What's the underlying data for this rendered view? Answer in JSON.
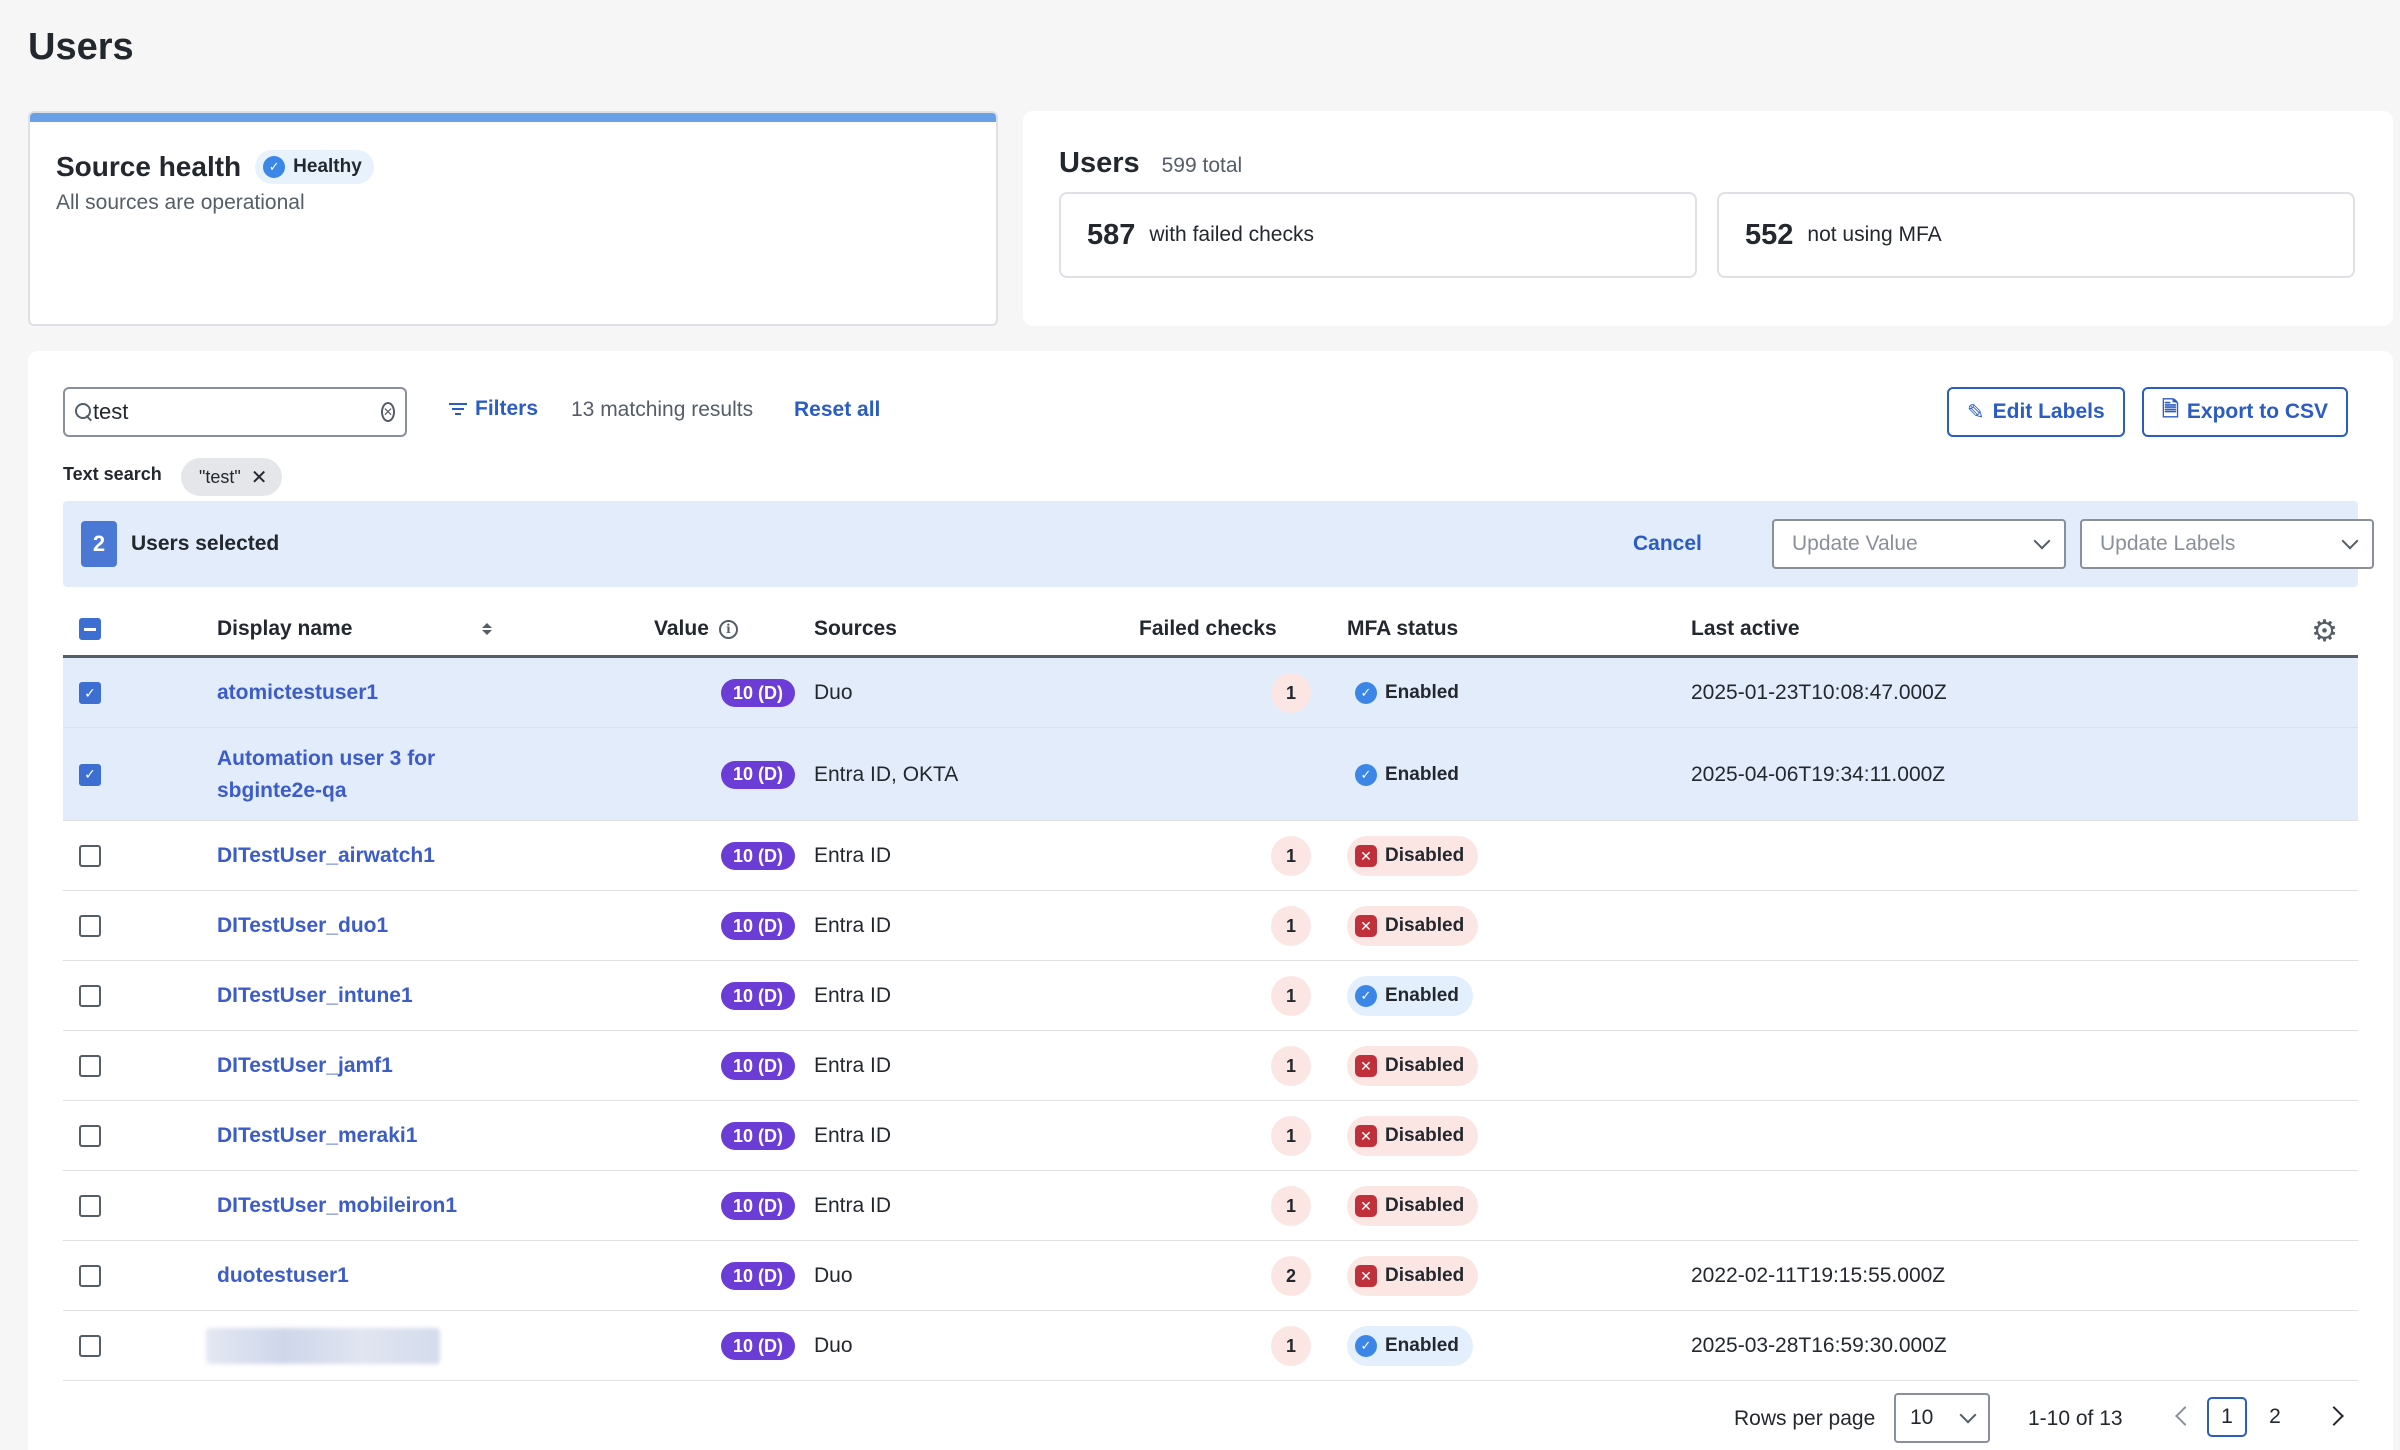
{
  "page_title": "Users",
  "source_health": {
    "title": "Source health",
    "badge": "Healthy",
    "subtitle": "All sources are operational"
  },
  "users_summary": {
    "title": "Users",
    "total": "599 total",
    "stats": [
      {
        "value": "587",
        "label": "with failed checks"
      },
      {
        "value": "552",
        "label": "not using MFA"
      }
    ]
  },
  "toolbar": {
    "search_value": "test",
    "filters_label": "Filters",
    "matching": "13 matching results",
    "reset_label": "Reset all",
    "edit_labels": "Edit Labels",
    "export_csv": "Export to CSV"
  },
  "text_search": {
    "label": "Text search",
    "chip": "\"test\""
  },
  "selection": {
    "count": "2",
    "label": "Users selected",
    "cancel": "Cancel",
    "update_value_placeholder": "Update Value",
    "update_labels_placeholder": "Update Labels"
  },
  "table": {
    "columns": {
      "display_name": "Display name",
      "value": "Value",
      "sources": "Sources",
      "failed_checks": "Failed checks",
      "mfa_status": "MFA status",
      "last_active": "Last active"
    },
    "rows": [
      {
        "name": "atomictestuser1",
        "value": "10 (D)",
        "sources": "Duo",
        "failed": "1",
        "mfa": "Enabled",
        "last_active": "2025-01-23T10:08:47.000Z",
        "selected": true
      },
      {
        "name": "Automation user 3 for",
        "name2": "sbginte2e-qa",
        "value": "10 (D)",
        "sources": "Entra ID, OKTA",
        "failed": "",
        "mfa": "Enabled",
        "last_active": "2025-04-06T19:34:11.000Z",
        "selected": true
      },
      {
        "name": "DITestUser_airwatch1",
        "value": "10 (D)",
        "sources": "Entra ID",
        "failed": "1",
        "mfa": "Disabled",
        "last_active": "",
        "selected": false
      },
      {
        "name": "DITestUser_duo1",
        "value": "10 (D)",
        "sources": "Entra ID",
        "failed": "1",
        "mfa": "Disabled",
        "last_active": "",
        "selected": false
      },
      {
        "name": "DITestUser_intune1",
        "value": "10 (D)",
        "sources": "Entra ID",
        "failed": "1",
        "mfa": "Enabled",
        "last_active": "",
        "selected": false
      },
      {
        "name": "DITestUser_jamf1",
        "value": "10 (D)",
        "sources": "Entra ID",
        "failed": "1",
        "mfa": "Disabled",
        "last_active": "",
        "selected": false
      },
      {
        "name": "DITestUser_meraki1",
        "value": "10 (D)",
        "sources": "Entra ID",
        "failed": "1",
        "mfa": "Disabled",
        "last_active": "",
        "selected": false
      },
      {
        "name": "DITestUser_mobileiron1",
        "value": "10 (D)",
        "sources": "Entra ID",
        "failed": "1",
        "mfa": "Disabled",
        "last_active": "",
        "selected": false
      },
      {
        "name": "duotestuser1",
        "value": "10 (D)",
        "sources": "Duo",
        "failed": "2",
        "mfa": "Disabled",
        "last_active": "2022-02-11T19:15:55.000Z",
        "selected": false
      },
      {
        "name": "",
        "value": "10 (D)",
        "sources": "Duo",
        "failed": "1",
        "mfa": "Enabled",
        "last_active": "2025-03-28T16:59:30.000Z",
        "selected": false,
        "redacted": true
      }
    ]
  },
  "pagination": {
    "rows_per_page_label": "Rows per page",
    "rows_per_page": "10",
    "range": "1-10 of 13",
    "pages": [
      "1",
      "2"
    ],
    "current": "1"
  },
  "colors": {
    "accent": "#2b5cc4",
    "value_pill": "#6b3dd6",
    "enabled": "#3c86e8",
    "disabled": "#c0303b",
    "selected_row": "#e3ecfb"
  }
}
